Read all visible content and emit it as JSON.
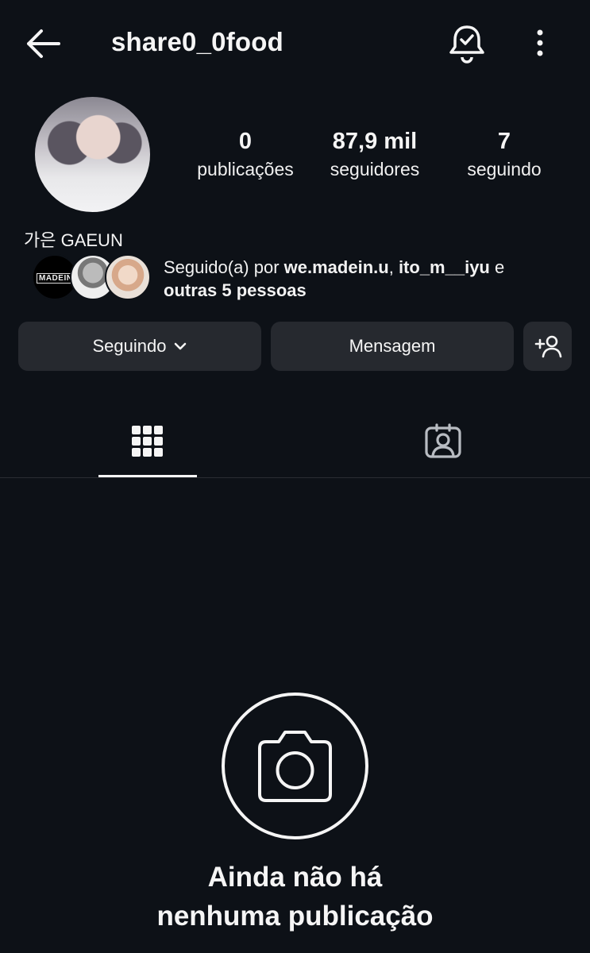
{
  "header": {
    "username": "share0_0food",
    "back_icon": "arrow-left-icon",
    "bell_icon": "bell-check-icon",
    "more_icon": "more-vertical-icon"
  },
  "profile": {
    "display_name": "가은 GAEUN",
    "stats": [
      {
        "value": "0",
        "label": "publicações"
      },
      {
        "value": "87,9 mil",
        "label": "seguidores"
      },
      {
        "value": "7",
        "label": "seguindo"
      }
    ],
    "followed_by": {
      "prefix": "Seguido(a) por ",
      "user1": "we.madein.u",
      "separator": ", ",
      "user2": "ito_m__iyu",
      "conjunction": " e",
      "others": "outras 5 pessoas",
      "avatar1_text": "MADEIN"
    }
  },
  "actions": {
    "following_label": "Seguindo",
    "message_label": "Mensagem",
    "add_user_icon": "add-user-icon"
  },
  "tabs": {
    "grid_icon": "grid-icon",
    "tagged_icon": "tagged-person-icon"
  },
  "empty_state": {
    "line1": "Ainda não há",
    "line2": "nenhuma publicação",
    "icon": "camera-icon"
  },
  "colors": {
    "background": "#0d1117",
    "button": "#26292f",
    "text": "#f5f5f5"
  }
}
